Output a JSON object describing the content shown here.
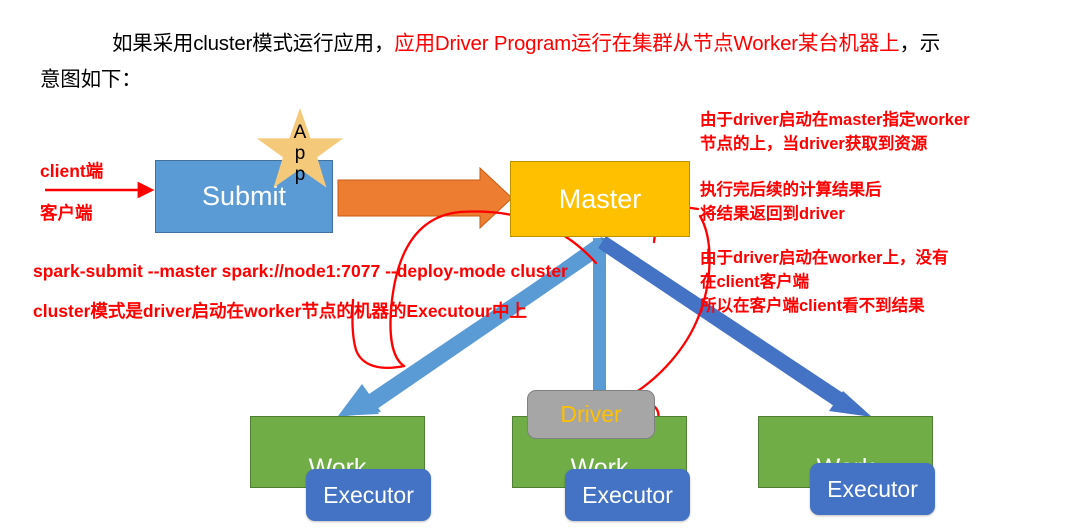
{
  "paragraph": {
    "line1_black_a": "如果采用cluster模式运行应用，",
    "line1_red": "应用Driver Program运行在集群从节点Worker某台机器上",
    "line1_black_b": "，示",
    "line2": "意图如下："
  },
  "diagram": {
    "submit_label": "Submit",
    "master_label": "Master",
    "driver_label": "Driver",
    "star_letters": [
      "A",
      "p",
      "p"
    ],
    "workers": [
      {
        "work_label": "Work",
        "executor_label": "Executor"
      },
      {
        "work_label": "Work",
        "executor_label": "Executor"
      },
      {
        "work_label": "Work",
        "executor_label": "Executor"
      }
    ]
  },
  "annotations": {
    "client_label": "client端",
    "customer_label": "客户端",
    "note_right_1": "由于driver启动在master指定worker\n节点的上，当driver获取到资源",
    "note_right_2": "执行完后续的计算结果后\n将结果返回到driver",
    "note_right_3": "由于driver启动在worker上，没有\n在client客户端\n所以在客户端client看不到结果",
    "command_line": "spark-submit --master spark://node1:7077 --deploy-mode cluster",
    "cluster_line": "cluster模式是driver启动在worker节点的机器的Executour中上"
  },
  "colors": {
    "submit_fill": "#5B9BD5",
    "master_fill": "#FFC000",
    "work_fill": "#70AD47",
    "executor_fill": "#4472C4",
    "driver_fill": "#A6A6A6",
    "driver_text": "#FFC000",
    "star_fill": "#F5C97A",
    "orange_arrow": "#ED7D31",
    "blue_arrow_light": "#5B9BD5",
    "blue_arrow_dark": "#4472C4",
    "annotation_red": "#FF0000"
  }
}
